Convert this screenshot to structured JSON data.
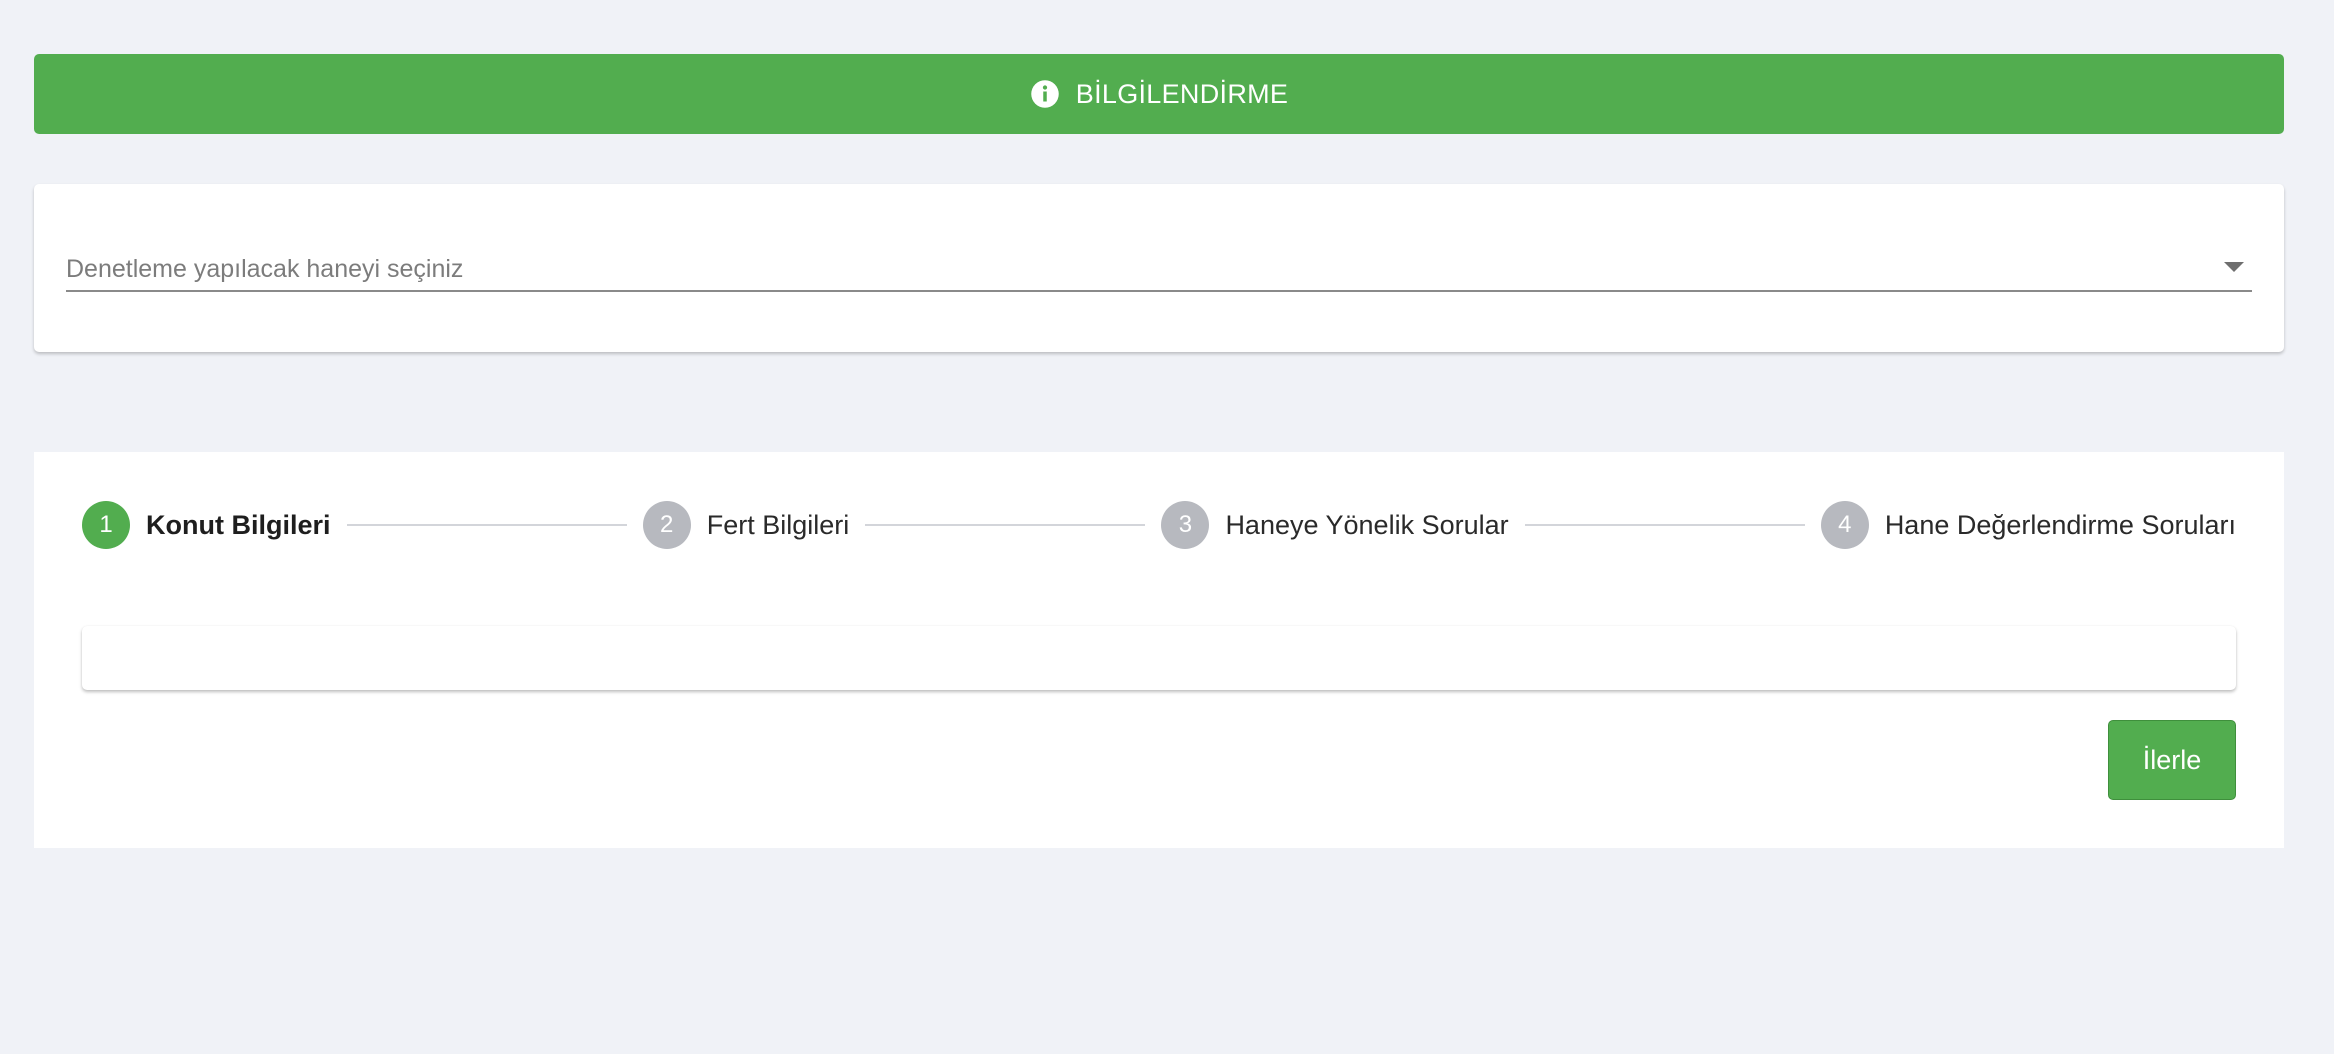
{
  "banner": {
    "icon": "info-icon",
    "title": "BİLGİLENDİRME",
    "color": "#52ad4f"
  },
  "household_select": {
    "placeholder": "Denetleme yapılacak haneyi seçiniz",
    "icon": "chevron-down-icon"
  },
  "stepper": {
    "active_color": "#52ad4f",
    "inactive_color": "#b7b9bf",
    "steps": [
      {
        "number": "1",
        "label": "Konut Bilgileri",
        "active": true
      },
      {
        "number": "2",
        "label": "Fert Bilgileri",
        "active": false
      },
      {
        "number": "3",
        "label": "Haneye Yönelik Sorular",
        "active": false
      },
      {
        "number": "4",
        "label": "Hane Değerlendirme Soruları",
        "active": false
      }
    ]
  },
  "actions": {
    "next_label": "İlerle"
  }
}
